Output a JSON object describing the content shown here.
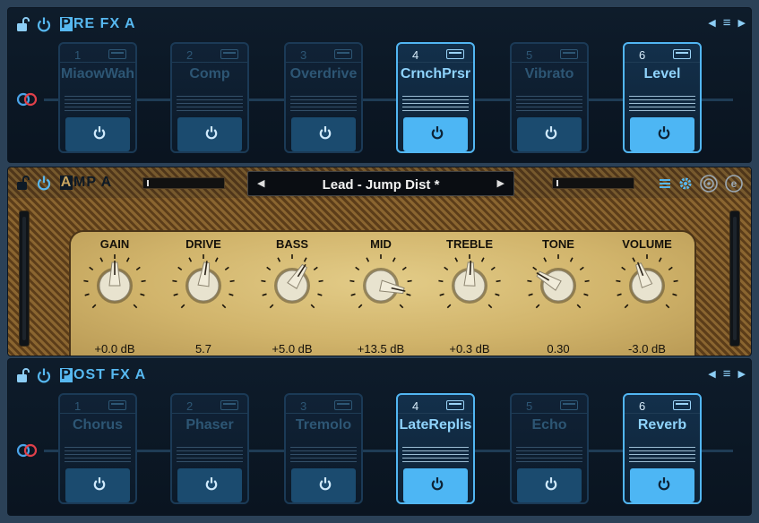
{
  "pre_fx": {
    "title_cap": "P",
    "title_rest": "RE FX A",
    "pedals": [
      {
        "num": "1",
        "name": "MiaowWah",
        "on": false
      },
      {
        "num": "2",
        "name": "Comp",
        "on": false
      },
      {
        "num": "3",
        "name": "Overdrive",
        "on": false
      },
      {
        "num": "4",
        "name": "CrnchPrsr",
        "on": true
      },
      {
        "num": "5",
        "name": "Vibrato",
        "on": false
      },
      {
        "num": "6",
        "name": "Level",
        "on": true
      }
    ]
  },
  "amp": {
    "title_cap": "A",
    "title_rest": "MP A",
    "preset": "Lead - Jump Dist *",
    "knobs": [
      {
        "label": "GAIN",
        "value": "+0.0 dB",
        "level": 0.5
      },
      {
        "label": "DRIVE",
        "value": "5.7",
        "level": 0.53
      },
      {
        "label": "BASS",
        "value": "+5.0 dB",
        "level": 0.62
      },
      {
        "label": "MID",
        "value": "+13.5 dB",
        "level": 0.88
      },
      {
        "label": "TREBLE",
        "value": "+0.3 dB",
        "level": 0.51
      },
      {
        "label": "TONE",
        "value": "0.30",
        "level": 0.28
      },
      {
        "label": "VOLUME",
        "value": "-3.0 dB",
        "level": 0.42
      }
    ]
  },
  "post_fx": {
    "title_cap": "P",
    "title_rest": "OST FX A",
    "pedals": [
      {
        "num": "1",
        "name": "Chorus",
        "on": false
      },
      {
        "num": "2",
        "name": "Phaser",
        "on": false
      },
      {
        "num": "3",
        "name": "Tremolo",
        "on": false
      },
      {
        "num": "4",
        "name": "LateReplis",
        "on": true
      },
      {
        "num": "5",
        "name": "Echo",
        "on": false
      },
      {
        "num": "6",
        "name": "Reverb",
        "on": true
      }
    ]
  },
  "colors": {
    "accent": "#52b6f2",
    "switch_on": "#4db6f4",
    "switch_off": "#1b4b6f"
  }
}
